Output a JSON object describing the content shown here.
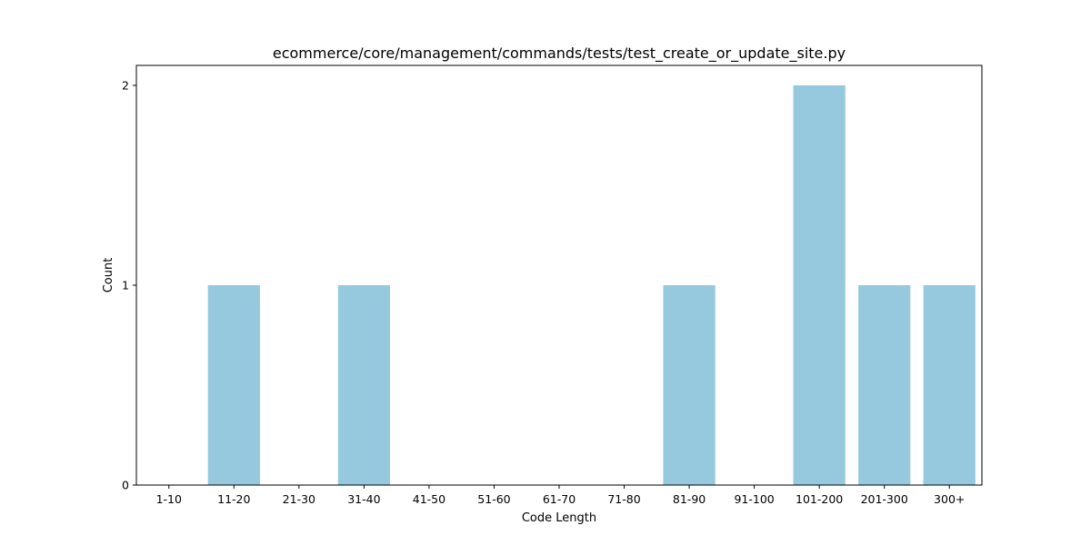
{
  "chart_data": {
    "type": "bar",
    "title": "ecommerce/core/management/commands/tests/test_create_or_update_site.py",
    "xlabel": "Code Length",
    "ylabel": "Count",
    "categories": [
      "1-10",
      "11-20",
      "21-30",
      "31-40",
      "41-50",
      "51-60",
      "61-70",
      "71-80",
      "81-90",
      "91-100",
      "101-200",
      "201-300",
      "300+"
    ],
    "values": [
      0,
      1,
      0,
      1,
      0,
      0,
      0,
      0,
      1,
      0,
      2,
      1,
      1
    ],
    "ylim": [
      0,
      2.1
    ],
    "yticks": [
      0,
      1,
      2
    ],
    "ytick_labels": [
      "0",
      "1",
      "2"
    ],
    "bar_color": "#96c9de",
    "grid": false,
    "legend": "none"
  }
}
